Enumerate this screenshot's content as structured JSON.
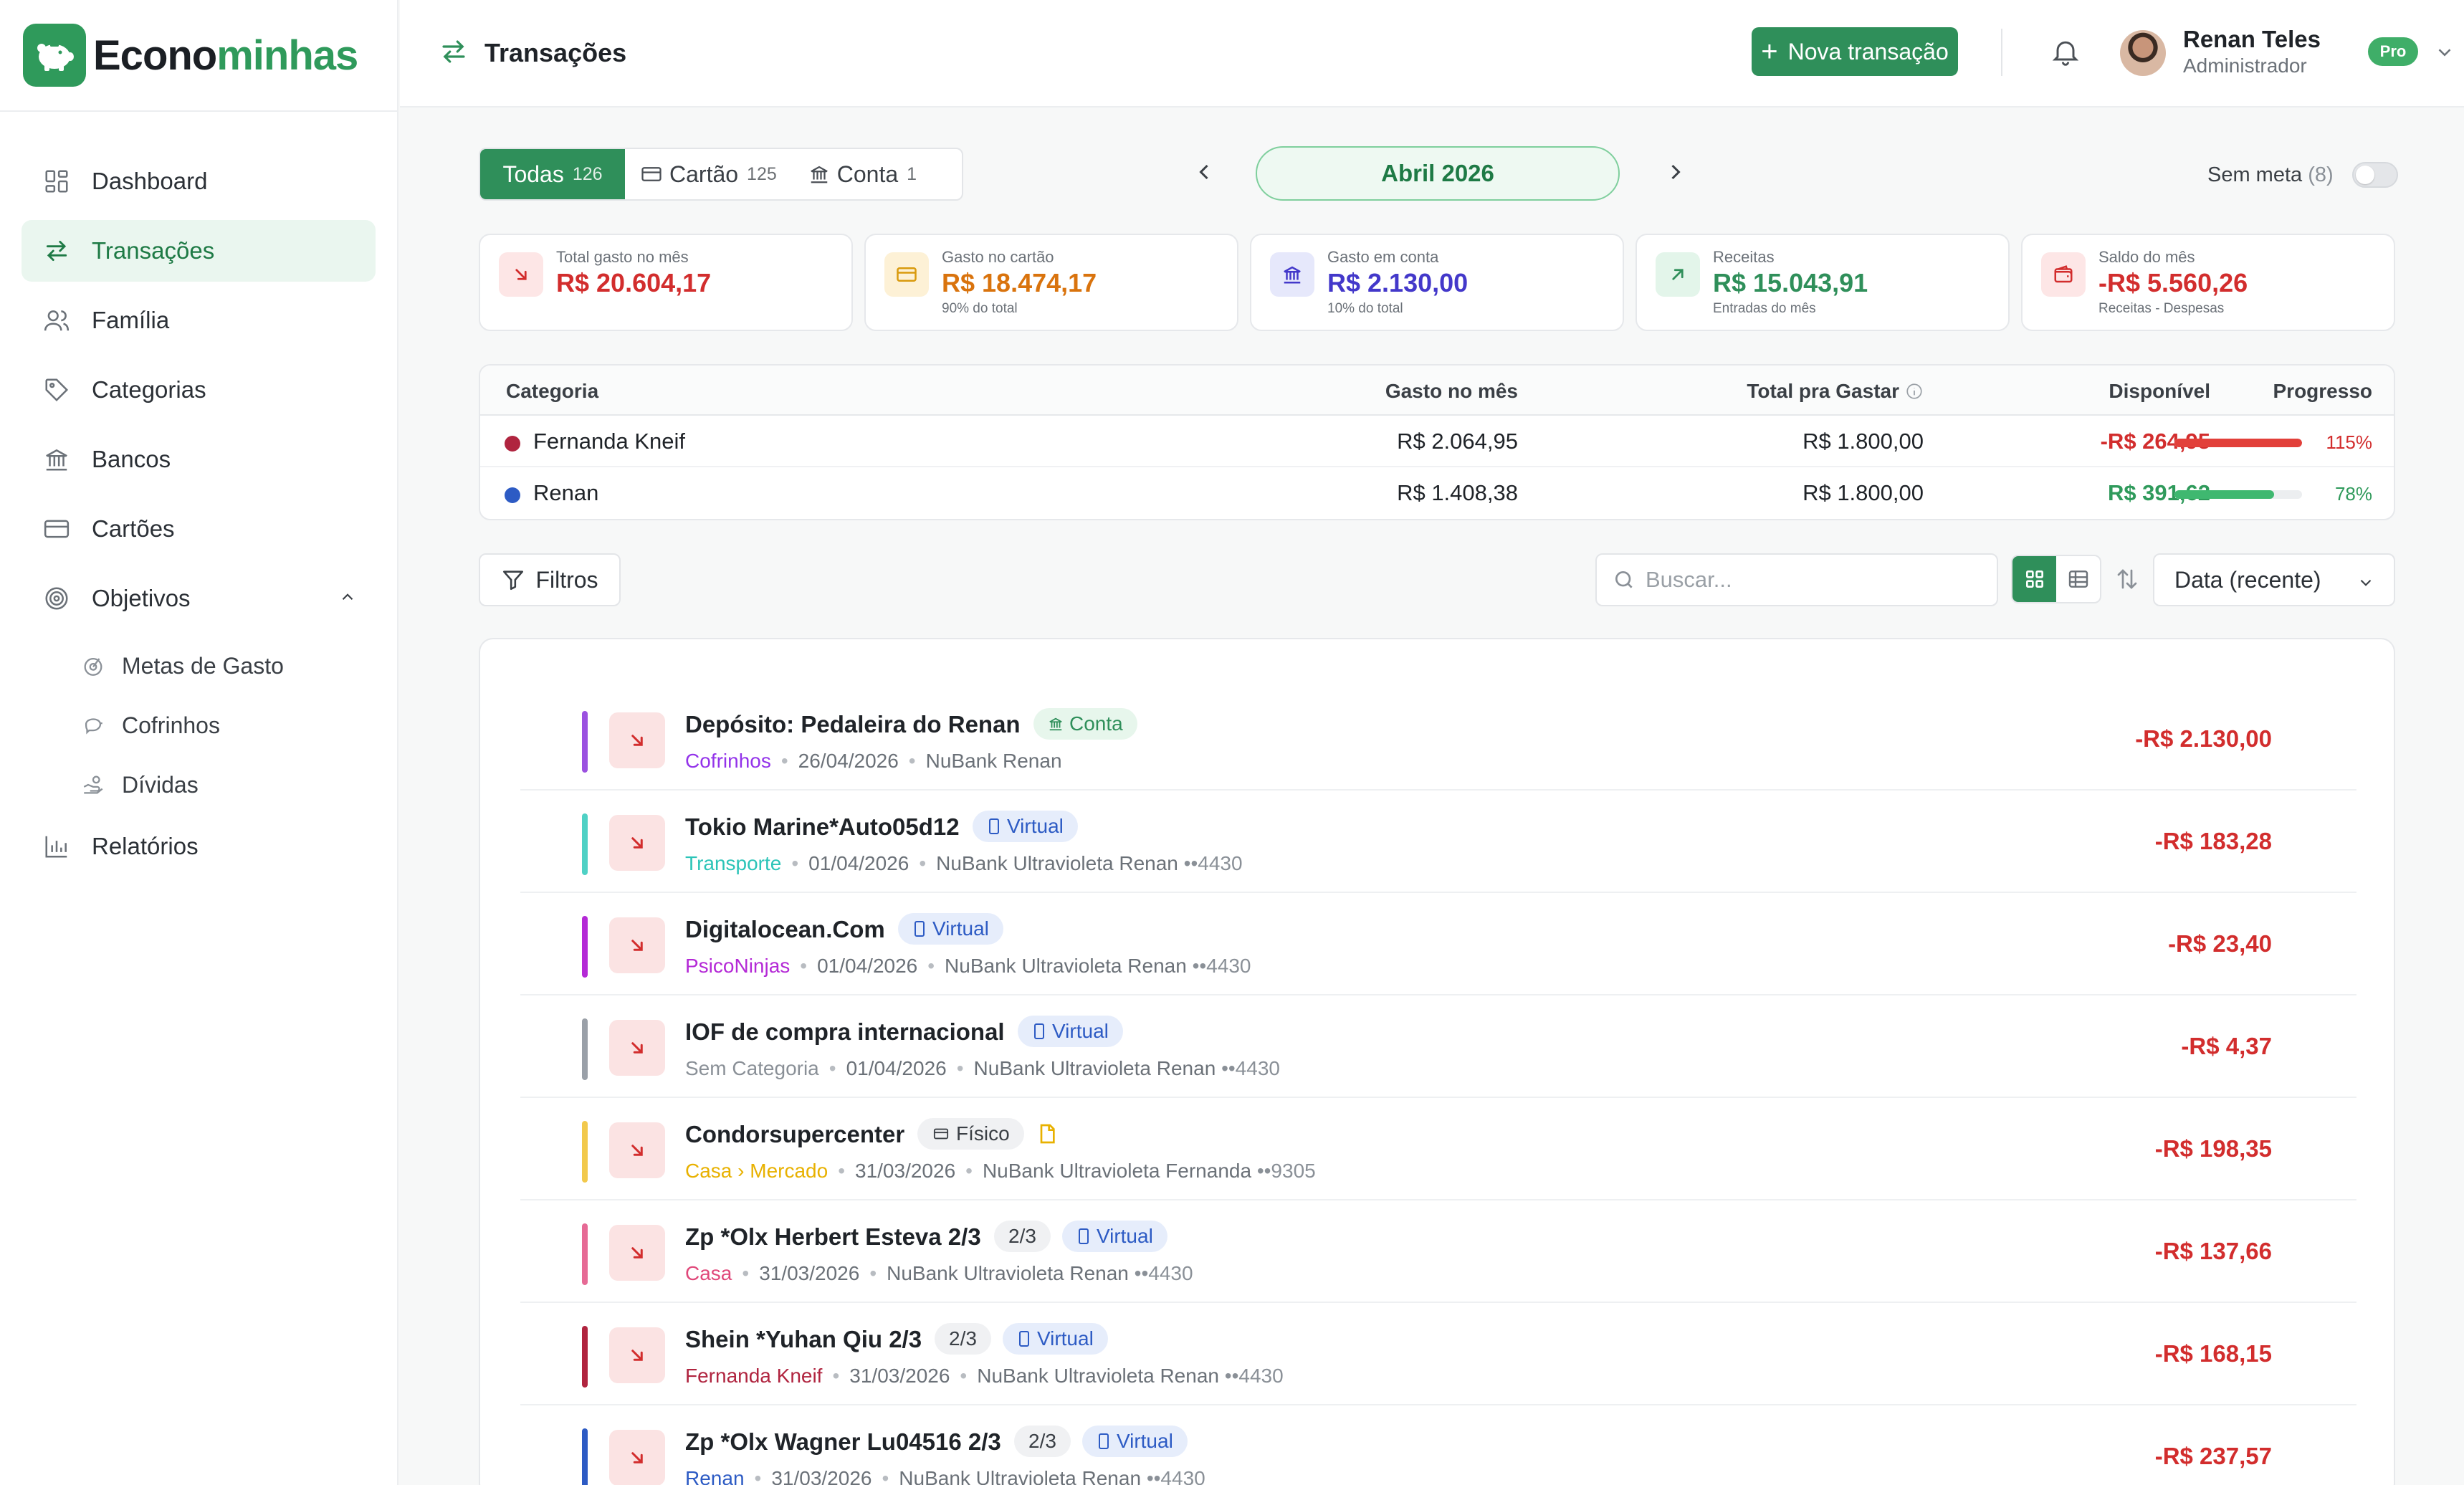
{
  "app": {
    "brand_prefix": "Econo",
    "brand_suffix": "minhas"
  },
  "sidebar": {
    "items": [
      {
        "label": "Dashboard"
      },
      {
        "label": "Transações"
      },
      {
        "label": "Família"
      },
      {
        "label": "Categorias"
      },
      {
        "label": "Bancos"
      },
      {
        "label": "Cartões"
      },
      {
        "label": "Objetivos"
      },
      {
        "label": "Metas de Gasto"
      },
      {
        "label": "Cofrinhos"
      },
      {
        "label": "Dívidas"
      },
      {
        "label": "Relatórios"
      }
    ]
  },
  "header": {
    "title": "Transações",
    "new_button": "Nova transação",
    "user_name": "Renan Teles",
    "user_role": "Administrador",
    "badge": "Pro"
  },
  "tabs": [
    {
      "label": "Todas",
      "count": "126"
    },
    {
      "label": "Cartão",
      "count": "125"
    },
    {
      "label": "Conta",
      "count": "1"
    }
  ],
  "month": "Abril 2026",
  "goal_filter": {
    "label": "Sem meta",
    "count": "(8)"
  },
  "cards": [
    {
      "label": "Total gasto no mês",
      "value": "R$ 20.604,17",
      "sub": "",
      "color": "#d22d2d"
    },
    {
      "label": "Gasto no cartão",
      "value": "R$ 18.474,17",
      "sub": "90% do total",
      "color": "#d9730d"
    },
    {
      "label": "Gasto em conta",
      "value": "R$ 2.130,00",
      "sub": "10% do total",
      "color": "#4338ca"
    },
    {
      "label": "Receitas",
      "value": "R$ 15.043,91",
      "sub": "Entradas do mês",
      "color": "#2f8f5a"
    },
    {
      "label": "Saldo do mês",
      "value": "-R$ 5.560,26",
      "sub": "Receitas - Despesas",
      "color": "#d22d2d"
    }
  ],
  "category_table": {
    "headers": {
      "category": "Categoria",
      "spent": "Gasto no mês",
      "budget": "Total pra Gastar",
      "available": "Disponível",
      "progress": "Progresso"
    },
    "rows": [
      {
        "name": "Fernanda Kneif",
        "dot": "#b0243f",
        "spent": "R$ 2.064,95",
        "budget": "R$ 1.800,00",
        "available": "-R$ 264,95",
        "available_color": "#d22d2d",
        "progress": 1.0,
        "bar_color": "#e2403a",
        "pct": "115%",
        "pct_color": "#d22d2d"
      },
      {
        "name": "Renan",
        "dot": "#2d5bc4",
        "spent": "R$ 1.408,38",
        "budget": "R$ 1.800,00",
        "available": "R$ 391,62",
        "available_color": "#2f9a5b",
        "progress": 0.78,
        "bar_color": "#3fb870",
        "pct": "78%",
        "pct_color": "#2f9a5b"
      }
    ]
  },
  "toolbar": {
    "filter_label": "Filtros",
    "search_placeholder": "Buscar...",
    "sort_label": "Data (recente)"
  },
  "transactions": [
    {
      "title": "Depósito: Pedaleira do Renan",
      "installment": "",
      "tag": "Conta",
      "tag_type": "conta",
      "doc": false,
      "category": "Cofrinhos",
      "category_color": "#9333ea",
      "date": "26/04/2026",
      "account": "NuBank Renan",
      "last4": "",
      "amount": "-R$ 2.130,00",
      "bar": "#9b51e0"
    },
    {
      "title": "Tokio Marine*Auto05d12",
      "installment": "",
      "tag": "Virtual",
      "tag_type": "virtual",
      "doc": false,
      "category": "Transporte",
      "category_color": "#2cc4b8",
      "date": "01/04/2026",
      "account": "NuBank Ultravioleta Renan",
      "last4": "••4430",
      "amount": "-R$ 183,28",
      "bar": "#4fd1c5"
    },
    {
      "title": "Digitalocean.Com",
      "installment": "",
      "tag": "Virtual",
      "tag_type": "virtual",
      "doc": false,
      "category": "PsicoNinjas",
      "category_color": "#b429d6",
      "date": "01/04/2026",
      "account": "NuBank Ultravioleta Renan",
      "last4": "••4430",
      "amount": "-R$ 23,40",
      "bar": "#b429d6"
    },
    {
      "title": "IOF de compra internacional",
      "installment": "",
      "tag": "Virtual",
      "tag_type": "virtual",
      "doc": false,
      "category": "Sem Categoria",
      "category_color": "#8a9097",
      "date": "01/04/2026",
      "account": "NuBank Ultravioleta Renan",
      "last4": "••4430",
      "amount": "-R$ 4,37",
      "bar": "#9aa0a8"
    },
    {
      "title": "Condorsupercenter",
      "installment": "",
      "tag": "Físico",
      "tag_type": "fisico",
      "doc": true,
      "category": "Casa › Mercado",
      "category_color": "#e8b100",
      "date": "31/03/2026",
      "account": "NuBank Ultravioleta Fernanda",
      "last4": "••9305",
      "amount": "-R$ 198,35",
      "bar": "#f2c94c"
    },
    {
      "title": "Zp *Olx Herbert Esteva 2/3",
      "installment": "2/3",
      "tag": "Virtual",
      "tag_type": "virtual",
      "doc": false,
      "category": "Casa",
      "category_color": "#e0487a",
      "date": "31/03/2026",
      "account": "NuBank Ultravioleta Renan",
      "last4": "••4430",
      "amount": "-R$ 137,66",
      "bar": "#e66a95"
    },
    {
      "title": "Shein *Yuhan Qiu 2/3",
      "installment": "2/3",
      "tag": "Virtual",
      "tag_type": "virtual",
      "doc": false,
      "category": "Fernanda Kneif",
      "category_color": "#b0243f",
      "date": "31/03/2026",
      "account": "NuBank Ultravioleta Renan",
      "last4": "••4430",
      "amount": "-R$ 168,15",
      "bar": "#b0243f"
    },
    {
      "title": "Zp *Olx Wagner Lu04516 2/3",
      "installment": "2/3",
      "tag": "Virtual",
      "tag_type": "virtual",
      "doc": false,
      "category": "Renan",
      "category_color": "#2d5bc4",
      "date": "31/03/2026",
      "account": "NuBank Ultravioleta Renan",
      "last4": "••4430",
      "amount": "-R$ 237,57",
      "bar": "#2d5bc4"
    }
  ]
}
